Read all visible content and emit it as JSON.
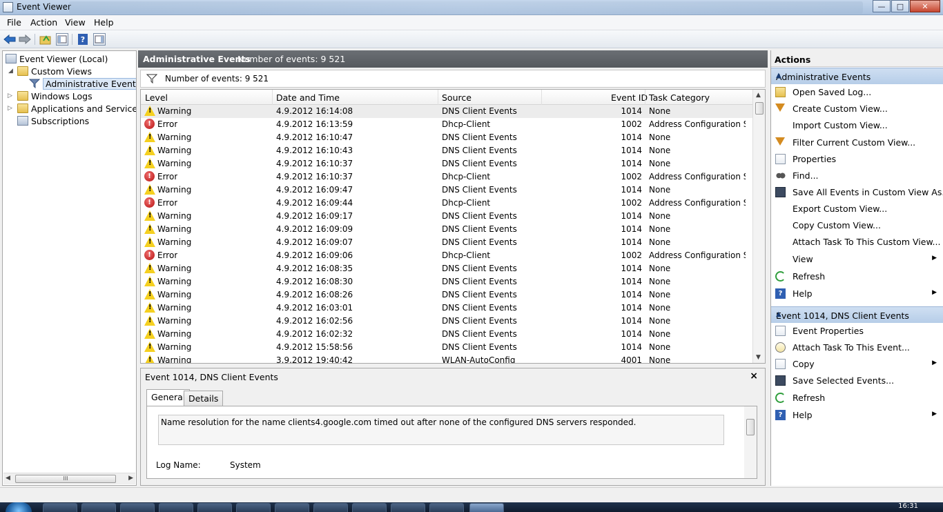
{
  "window": {
    "title": "Event Viewer"
  },
  "menu": [
    "File",
    "Action",
    "View",
    "Help"
  ],
  "tree": {
    "root": "Event Viewer (Local)",
    "custom_views": "Custom Views",
    "administrative_events": "Administrative Events",
    "windows_logs": "Windows Logs",
    "apps_services": "Applications and Services Lo",
    "subscriptions": "Subscriptions",
    "hscroll_grip": "III"
  },
  "center": {
    "header_title": "Administrative Events",
    "header_count": "Number of events: 9 521",
    "filter_text": "Number of events: 9 521",
    "columns": {
      "level": "Level",
      "datetime": "Date and Time",
      "source": "Source",
      "event_id": "Event ID",
      "task_category": "Task Category"
    },
    "rows": [
      {
        "level": "Warning",
        "datetime": "4.9.2012 16:14:08",
        "source": "DNS Client Events",
        "event_id": "1014",
        "task_category": "None"
      },
      {
        "level": "Error",
        "datetime": "4.9.2012 16:13:59",
        "source": "Dhcp-Client",
        "event_id": "1002",
        "task_category": "Address Configuration S..."
      },
      {
        "level": "Warning",
        "datetime": "4.9.2012 16:10:47",
        "source": "DNS Client Events",
        "event_id": "1014",
        "task_category": "None"
      },
      {
        "level": "Warning",
        "datetime": "4.9.2012 16:10:43",
        "source": "DNS Client Events",
        "event_id": "1014",
        "task_category": "None"
      },
      {
        "level": "Warning",
        "datetime": "4.9.2012 16:10:37",
        "source": "DNS Client Events",
        "event_id": "1014",
        "task_category": "None"
      },
      {
        "level": "Error",
        "datetime": "4.9.2012 16:10:37",
        "source": "Dhcp-Client",
        "event_id": "1002",
        "task_category": "Address Configuration S..."
      },
      {
        "level": "Warning",
        "datetime": "4.9.2012 16:09:47",
        "source": "DNS Client Events",
        "event_id": "1014",
        "task_category": "None"
      },
      {
        "level": "Error",
        "datetime": "4.9.2012 16:09:44",
        "source": "Dhcp-Client",
        "event_id": "1002",
        "task_category": "Address Configuration S..."
      },
      {
        "level": "Warning",
        "datetime": "4.9.2012 16:09:17",
        "source": "DNS Client Events",
        "event_id": "1014",
        "task_category": "None"
      },
      {
        "level": "Warning",
        "datetime": "4.9.2012 16:09:09",
        "source": "DNS Client Events",
        "event_id": "1014",
        "task_category": "None"
      },
      {
        "level": "Warning",
        "datetime": "4.9.2012 16:09:07",
        "source": "DNS Client Events",
        "event_id": "1014",
        "task_category": "None"
      },
      {
        "level": "Error",
        "datetime": "4.9.2012 16:09:06",
        "source": "Dhcp-Client",
        "event_id": "1002",
        "task_category": "Address Configuration S..."
      },
      {
        "level": "Warning",
        "datetime": "4.9.2012 16:08:35",
        "source": "DNS Client Events",
        "event_id": "1014",
        "task_category": "None"
      },
      {
        "level": "Warning",
        "datetime": "4.9.2012 16:08:30",
        "source": "DNS Client Events",
        "event_id": "1014",
        "task_category": "None"
      },
      {
        "level": "Warning",
        "datetime": "4.9.2012 16:08:26",
        "source": "DNS Client Events",
        "event_id": "1014",
        "task_category": "None"
      },
      {
        "level": "Warning",
        "datetime": "4.9.2012 16:03:01",
        "source": "DNS Client Events",
        "event_id": "1014",
        "task_category": "None"
      },
      {
        "level": "Warning",
        "datetime": "4.9.2012 16:02:56",
        "source": "DNS Client Events",
        "event_id": "1014",
        "task_category": "None"
      },
      {
        "level": "Warning",
        "datetime": "4.9.2012 16:02:32",
        "source": "DNS Client Events",
        "event_id": "1014",
        "task_category": "None"
      },
      {
        "level": "Warning",
        "datetime": "4.9.2012 15:58:56",
        "source": "DNS Client Events",
        "event_id": "1014",
        "task_category": "None"
      },
      {
        "level": "Warning",
        "datetime": "3.9.2012 19:40:42",
        "source": "WLAN-AutoConfig",
        "event_id": "4001",
        "task_category": "None"
      }
    ],
    "detail": {
      "title": "Event 1014, DNS Client Events",
      "close": "×",
      "tab_general": "General",
      "tab_details": "Details",
      "description": "Name resolution for the name clients4.google.com timed out after none of the configured DNS servers responded.",
      "log_name_label": "Log Name:",
      "log_name_value": "System"
    }
  },
  "actions": {
    "title": "Actions",
    "section1": {
      "title": "Administrative Events",
      "items": [
        {
          "label": "Open Saved Log...",
          "icon": "folder-icon"
        },
        {
          "label": "Create Custom View...",
          "icon": "funnel-icon"
        },
        {
          "label": "Import Custom View...",
          "icon": ""
        },
        {
          "label": "Filter Current Custom View...",
          "icon": "funnel-icon"
        },
        {
          "label": "Properties",
          "icon": "properties-icon"
        },
        {
          "label": "Find...",
          "icon": "find-icon"
        },
        {
          "label": "Save All Events in Custom View As...",
          "icon": "save-icon"
        },
        {
          "label": "Export Custom View...",
          "icon": ""
        },
        {
          "label": "Copy Custom View...",
          "icon": ""
        },
        {
          "label": "Attach Task To This Custom View...",
          "icon": ""
        },
        {
          "label": "View",
          "icon": "",
          "submenu": true
        },
        {
          "label": "Refresh",
          "icon": "refresh-icon"
        },
        {
          "label": "Help",
          "icon": "help-icon",
          "submenu": true
        }
      ]
    },
    "section2": {
      "title": "Event 1014, DNS Client Events",
      "items": [
        {
          "label": "Event Properties",
          "icon": "properties-icon"
        },
        {
          "label": "Attach Task To This Event...",
          "icon": "task-icon"
        },
        {
          "label": "Copy",
          "icon": "copy-icon",
          "submenu": true
        },
        {
          "label": "Save Selected Events...",
          "icon": "save-icon"
        },
        {
          "label": "Refresh",
          "icon": "refresh-icon"
        },
        {
          "label": "Help",
          "icon": "help-icon",
          "submenu": true
        }
      ]
    }
  },
  "taskbar": {
    "clock": "16:31"
  }
}
